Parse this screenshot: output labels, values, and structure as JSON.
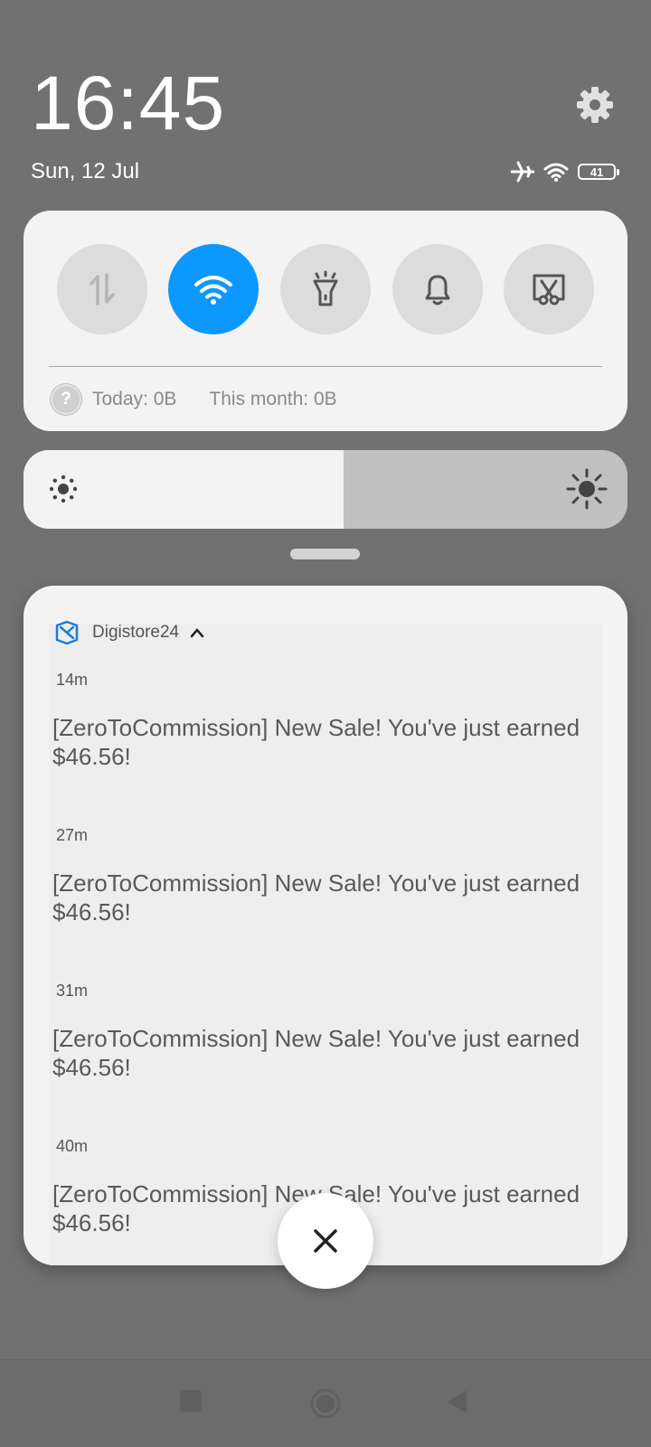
{
  "status": {
    "time": "16:45",
    "date": "Sun, 12 Jul",
    "battery_level": "41",
    "icons": [
      "airplane-icon",
      "wifi-icon",
      "battery-icon"
    ]
  },
  "quick_settings": {
    "tiles": [
      {
        "name": "mobile-data",
        "icon": "data-transfer-icon",
        "active": false
      },
      {
        "name": "wifi",
        "icon": "wifi-icon",
        "active": true
      },
      {
        "name": "flashlight",
        "icon": "flashlight-icon",
        "active": false
      },
      {
        "name": "sound",
        "icon": "bell-icon",
        "active": false
      },
      {
        "name": "screenshot",
        "icon": "scissors-screen-icon",
        "active": false
      }
    ],
    "data_usage": {
      "today": "Today: 0B",
      "month": "This month: 0B"
    },
    "accent_color": "#0c98ff"
  },
  "brightness": {
    "level": 0.53
  },
  "notification": {
    "app_name": "Digistore24",
    "items": [
      {
        "time": "14m",
        "text": "[ZeroToCommission] New Sale! You've just earned $46.56!"
      },
      {
        "time": "27m",
        "text": "[ZeroToCommission] New Sale! You've just earned $46.56!"
      },
      {
        "time": "31m",
        "text": "[ZeroToCommission] New Sale! You've just earned $46.56!"
      },
      {
        "time": "40m",
        "text": "[ZeroToCommission] New Sale! You've just earned $46.56!"
      }
    ]
  }
}
